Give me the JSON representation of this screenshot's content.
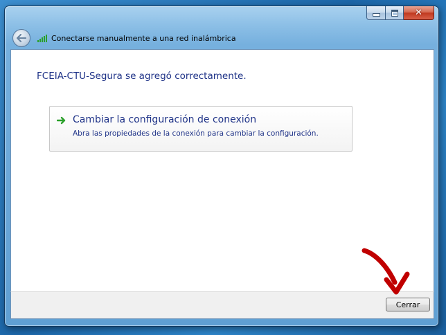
{
  "window": {
    "title": "Conectarse manualmente a una red inalámbrica",
    "caption_close_glyph": "✕"
  },
  "main": {
    "heading": "FCEIA-CTU-Segura se agregó correctamente.",
    "option": {
      "title": "Cambiar la configuración de conexión",
      "description": "Abra las propiedades de la conexión para cambiar la configuración."
    }
  },
  "footer": {
    "close_label": "Cerrar"
  },
  "colors": {
    "link_blue": "#1e3287",
    "arrow_green": "#2aa02a",
    "annotation_red": "#c00000"
  },
  "icons": {
    "back": "back-arrow-icon",
    "network": "wireless-signal-icon",
    "option": "green-arrow-icon"
  }
}
